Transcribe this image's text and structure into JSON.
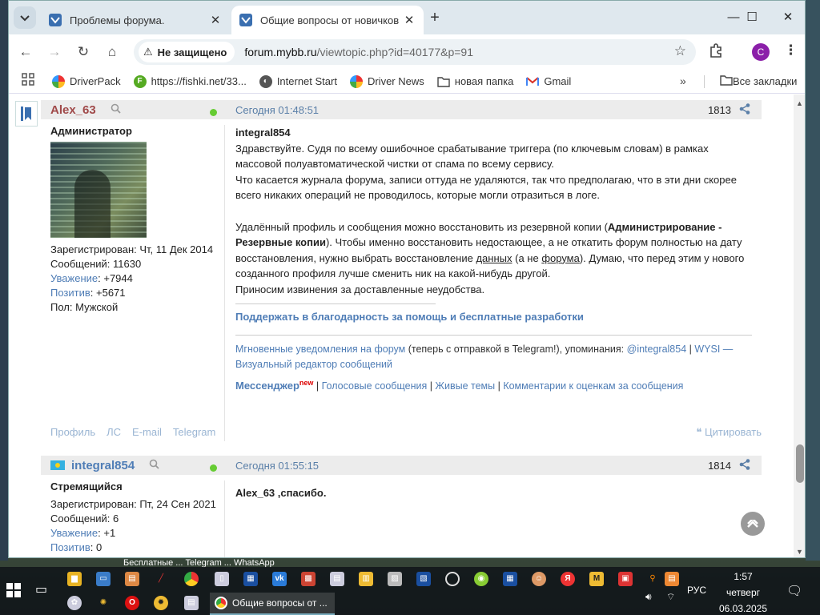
{
  "browser": {
    "tabs": [
      {
        "title": "Проблемы форума.",
        "active": false
      },
      {
        "title": "Общие вопросы от новичков",
        "active": true
      }
    ],
    "security_label": "Не защищено",
    "url_host": "forum.mybb.ru",
    "url_path": "/viewtopic.php?id=40177&p=91",
    "profile_initial": "C",
    "bookmarks": [
      {
        "label": "DriverPack",
        "icon": "driverpack-icon",
        "color": "#f5a623"
      },
      {
        "label": "https://fishki.net/33...",
        "icon": "fishki-icon",
        "color": "#55aa22"
      },
      {
        "label": "Internet Start",
        "icon": "globe-icon",
        "color": "#555555"
      },
      {
        "label": "Driver News",
        "icon": "driverpack-icon",
        "color": "#f5a623"
      },
      {
        "label": "новая папка",
        "icon": "folder-icon",
        "color": "#444444"
      },
      {
        "label": "Gmail",
        "icon": "gmail-icon",
        "color": "#d93025"
      }
    ],
    "all_bookmarks_label": "Все закладки"
  },
  "posts": [
    {
      "author": "Alex_63",
      "author_color": "#a04a4a",
      "date": "Сегодня 01:48:51",
      "number": "1813",
      "rank": "Администратор",
      "stats": {
        "registered": "Зарегистрирован: Чт, 11 Дек 2014",
        "messages": "Сообщений: 11630",
        "respect_label": "Уважение",
        "respect_value": ": +7944",
        "positive_label": "Позитив",
        "positive_value": ": +5671",
        "gender": "Пол: Мужской"
      },
      "quote_to": "integral854",
      "paragraph1_lines": [
        "Здравствуйте. Судя по всему ошибочное срабатывание триггера (по ключевым словам) в рамках",
        "массовой полуавтоматической чистки от спама по всему сервису.",
        "Что касается журнала форума, записи оттуда не удаляются, так что предполагаю, что в эти дни скорее",
        "всего никаких операций не проводилось, которые могли отразиться в логе."
      ],
      "p2": {
        "t1": "Удалённый профиль и сообщения можно восстановить из резервной копии (",
        "b1": "Администрирование -",
        "b2": "Резервные копии",
        "t2": "). Чтобы именно восстановить недостающее, а не откатить форум полностью на дату",
        "t3": "восстановления, нужно выбрать восстановление ",
        "u1": "данных",
        "t4": " (а не ",
        "u2": "форума",
        "t5": "). Думаю, что перед этим у нового",
        "t6": "созданного профиля лучше сменить ник на какой-нибудь другой.",
        "t7": "Приносим извинения за доставленные неудобства."
      },
      "signature": {
        "support": "Поддержать в благодарность за помощь и бесплатные разработки",
        "l1": "Мгновенные уведомления на форум",
        "t1": " (теперь с отправкой в Telegram!), упоминания: ",
        "l2": "@integral854",
        "sep": " | ",
        "l3": "WYSI — Визуальный редактор сообщений",
        "messenger": "Мессенджер",
        "new_badge": "new",
        "l4": "Голосовые сообщения",
        "l5": "Живые темы",
        "l6": "Комментарии к оценкам за сообщения"
      },
      "user_links": [
        "Профиль",
        "ЛС",
        "E-mail",
        "Telegram"
      ],
      "quote_label": "Цитировать"
    },
    {
      "author": "integral854",
      "author_color": "#4f7db6",
      "date": "Сегодня 01:55:15",
      "number": "1814",
      "rank": "Стремящийся",
      "stats": {
        "registered": "Зарегистрирован: Пт, 24 Сен 2021",
        "messages": "Сообщений: 6",
        "respect_label": "Уважение",
        "respect_value": ": +1",
        "positive_label": "Позитив",
        "positive_value": ": 0"
      },
      "text": "Alex_63 ,спасибо."
    }
  ],
  "taskbar": {
    "overlay_text": "Бесплатные ... Telegram ... WhatsApp",
    "active_window": "Общие вопросы от ...",
    "lang": "РУС",
    "time": "1:57",
    "day": "четверг",
    "date": "06.03.2025"
  }
}
